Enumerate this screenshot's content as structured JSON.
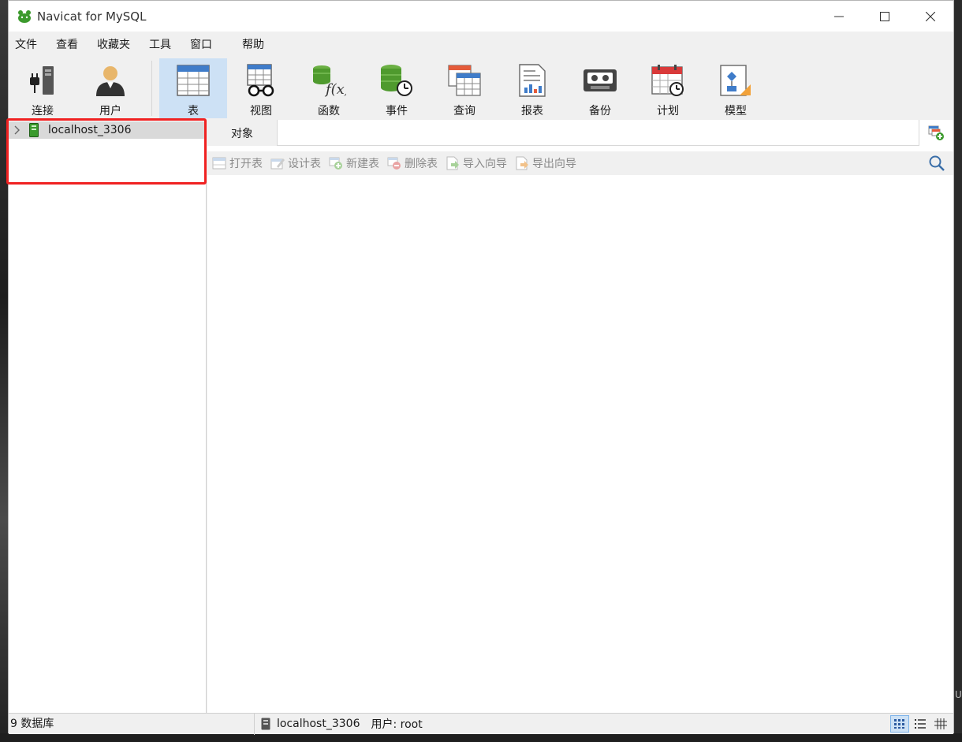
{
  "window": {
    "title": "Navicat for MySQL"
  },
  "menu": [
    "文件",
    "查看",
    "收藏夹",
    "工具",
    "窗口",
    "帮助"
  ],
  "toolbar": {
    "connect_label": "连接",
    "user_label": "用户",
    "table_label": "表",
    "view_label": "视图",
    "function_label": "函数",
    "event_label": "事件",
    "query_label": "查询",
    "report_label": "报表",
    "backup_label": "备份",
    "schedule_label": "计划",
    "model_label": "模型"
  },
  "tree": {
    "connection_name": "localhost_3306"
  },
  "objects": {
    "tab_label": "对象",
    "open_table": "打开表",
    "design_table": "设计表",
    "new_table": "新建表",
    "delete_table": "删除表",
    "import_wizard": "导入向导",
    "export_wizard": "导出向导"
  },
  "status": {
    "db_count": "9 数据库",
    "connection": "localhost_3306",
    "user": "用户: root"
  },
  "colors": {
    "accent": "#cde1f5",
    "highlight": "#f02121"
  }
}
